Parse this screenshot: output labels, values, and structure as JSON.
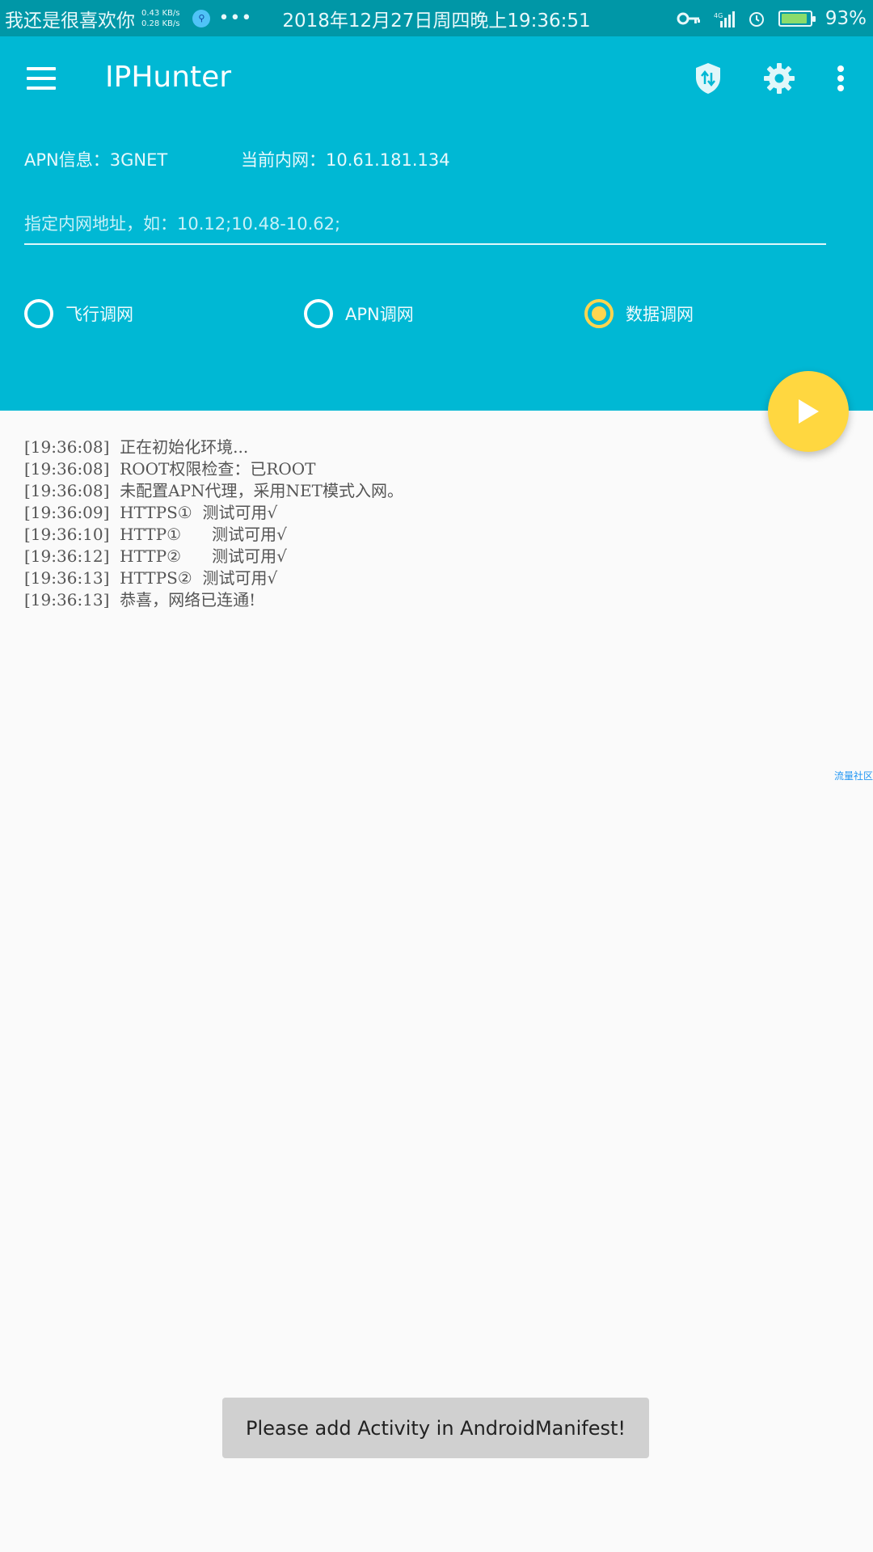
{
  "status_bar": {
    "carrier_text": "我还是很喜欢你",
    "upload_speed": "0.43 KB/s",
    "download_speed": "0.28 KB/s",
    "more": "•••",
    "datetime": "2018年12月27日周四晚上19:36:51",
    "battery": "93%"
  },
  "toolbar": {
    "title": "IPHunter"
  },
  "info": {
    "apn": "APN信息：3GNET",
    "intranet": "当前内网：10.61.181.134"
  },
  "ip_input": {
    "placeholder": "指定内网地址，如：10.12;10.48-10.62;",
    "value": ""
  },
  "modes": [
    {
      "label": "飞行调网",
      "selected": false
    },
    {
      "label": "APN调网",
      "selected": false
    },
    {
      "label": "数据调网",
      "selected": true
    }
  ],
  "log": [
    "[19:36:08]  正在初始化环境...",
    "[19:36:08]  ROOT权限检查：已ROOT",
    "[19:36:08]  未配置APN代理，采用NET模式入网。",
    "[19:36:09]  HTTPS①  测试可用√",
    "[19:36:10]  HTTP①      测试可用√",
    "[19:36:12]  HTTP②      测试可用√",
    "[19:36:13]  HTTPS②  测试可用√",
    "[19:36:13]  恭喜，网络已连通!"
  ],
  "watermark": "流量社区",
  "toast": "Please add Activity in AndroidManifest!",
  "colors": {
    "status_bar": "#0097a7",
    "primary": "#00b8d4",
    "accent": "#ffd740",
    "background": "#fafafa"
  },
  "icons": {
    "shield": "shield-sync-icon",
    "settings": "gear-icon",
    "more": "more-vert-icon",
    "play": "play-icon"
  }
}
